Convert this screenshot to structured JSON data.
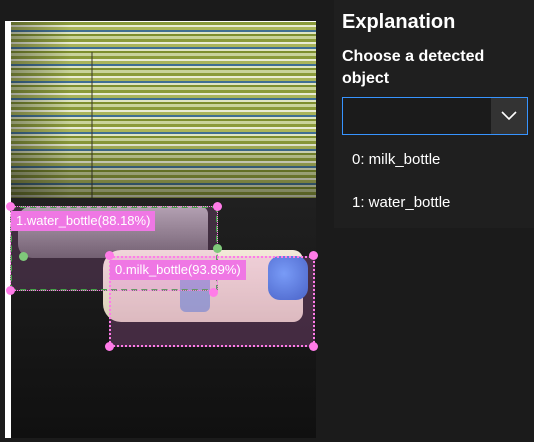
{
  "viewer": {
    "detections": [
      {
        "label": "1.water_bottle(88.18%)"
      },
      {
        "label": "0.milk_bottle(93.89%)"
      }
    ],
    "colors": {
      "box_fill": "#ef77e4",
      "water_border": "#43a047"
    }
  },
  "panel": {
    "title": "Explanation",
    "subtitle": "Choose a detected object",
    "dropdown": {
      "value": "",
      "icon": "chevron-down-icon"
    },
    "options": [
      {
        "label": "0: milk_bottle"
      },
      {
        "label": "1: water_bottle"
      }
    ],
    "colors": {
      "accent": "#3794ff"
    }
  }
}
